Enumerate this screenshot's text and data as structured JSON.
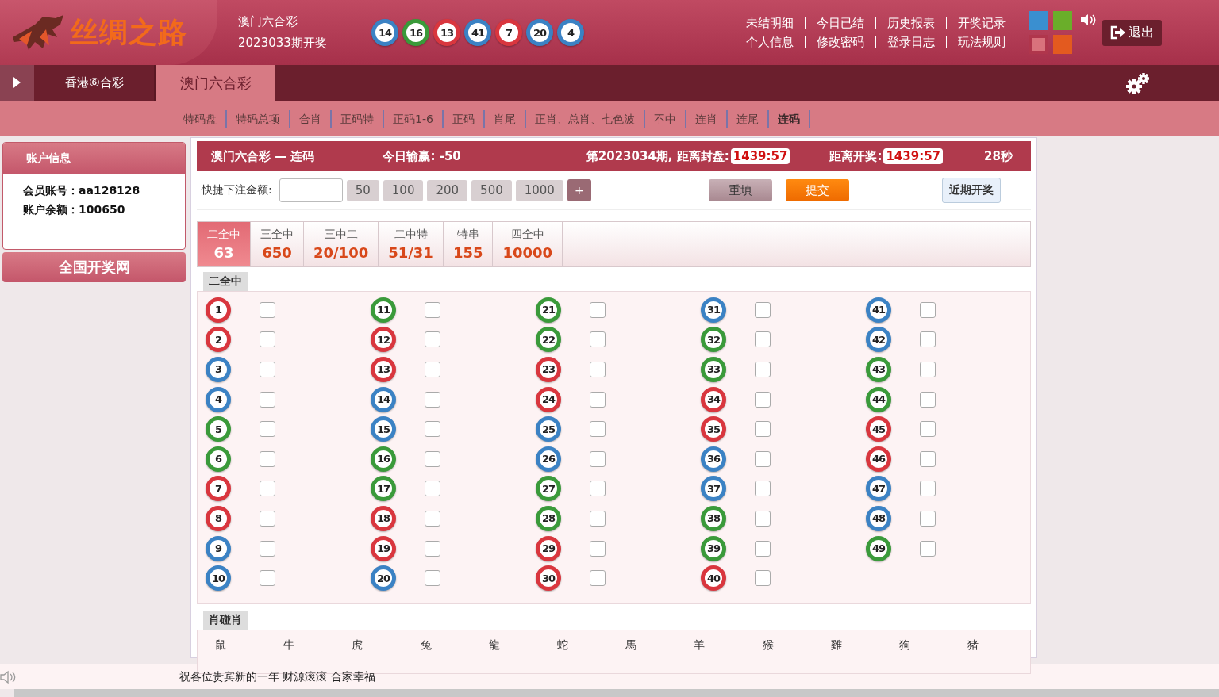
{
  "header": {
    "logo_text": "丝绸之路",
    "draw": {
      "lottery": "澳门六合彩",
      "period": "2023033期开奖",
      "balls": [
        {
          "number": "14",
          "color": "#3b82c4"
        },
        {
          "number": "16",
          "color": "#3a9a3a"
        },
        {
          "number": "13",
          "color": "#d9363e"
        },
        {
          "number": "41",
          "color": "#3b82c4"
        },
        {
          "number": "7",
          "color": "#d9363e"
        },
        {
          "number": "20",
          "color": "#3b82c4"
        },
        {
          "number": "4",
          "color": "#3b82c4"
        }
      ]
    },
    "links": [
      [
        "未结明细",
        "今日已结",
        "历史报表",
        "开奖记录"
      ],
      [
        "个人信息",
        "修改密码",
        "登录日志",
        "玩法规则"
      ]
    ],
    "themes": [
      {
        "color": "#3a8fd0",
        "selected": false
      },
      {
        "color": "#6aae2a",
        "selected": false
      },
      {
        "color": "#d9727c",
        "selected": true
      },
      {
        "color": "#e35a1f",
        "selected": false
      }
    ],
    "logout": "退出"
  },
  "tabs": [
    {
      "label": "香港⑥合彩",
      "selected": false
    },
    {
      "label": "澳门六合彩",
      "selected": true
    }
  ],
  "sub_nav": [
    {
      "label": "特码盘",
      "selected": false
    },
    {
      "label": "特码总项",
      "selected": false
    },
    {
      "label": "合肖",
      "selected": false
    },
    {
      "label": "正码特",
      "selected": false
    },
    {
      "label": "正码1-6",
      "selected": false
    },
    {
      "label": "正码",
      "selected": false
    },
    {
      "label": "肖尾",
      "selected": false
    },
    {
      "label": "正肖、总肖、七色波",
      "selected": false
    },
    {
      "label": "不中",
      "selected": false
    },
    {
      "label": "连肖",
      "selected": false
    },
    {
      "label": "连尾",
      "selected": false
    },
    {
      "label": "连码",
      "selected": true
    }
  ],
  "sidebar": {
    "title": "账户信息",
    "fields": [
      {
        "label": "会员账号：",
        "value": "aa128128"
      },
      {
        "label": "账户余额：",
        "value": "100650"
      }
    ],
    "button": "全国开奖网"
  },
  "panel": {
    "title": "澳门六合彩 — 连码",
    "today_label": "今日输赢:",
    "today_value": "-50",
    "close_label": "第2023034期, 距离封盘:",
    "close_timer": "1439:57",
    "draw_label": "距离开奖:",
    "draw_timer": "1439:57",
    "countdown": "28秒",
    "quick_label": "快捷下注金额:",
    "amounts": [
      "50",
      "100",
      "200",
      "500",
      "1000"
    ],
    "add": "+",
    "reset": "重填",
    "submit": "提交",
    "recent": "近期开奖",
    "play_types": [
      {
        "name": "二全中",
        "odds": "63",
        "selected": true
      },
      {
        "name": "三全中",
        "odds": "650",
        "selected": false
      },
      {
        "name": "三中二",
        "odds": "20/100",
        "selected": false
      },
      {
        "name": "二中特",
        "odds": "51/31",
        "selected": false
      },
      {
        "name": "特串",
        "odds": "155",
        "selected": false
      },
      {
        "name": "四全中",
        "odds": "10000",
        "selected": false
      }
    ],
    "numbers_title": "二全中",
    "numbers": [
      {
        "number": "1",
        "color": "#d9363e",
        "checked": false
      },
      {
        "number": "2",
        "color": "#d9363e",
        "checked": false
      },
      {
        "number": "3",
        "color": "#3b82c4",
        "checked": false
      },
      {
        "number": "4",
        "color": "#3b82c4",
        "checked": false
      },
      {
        "number": "5",
        "color": "#3a9a3a",
        "checked": false
      },
      {
        "number": "6",
        "color": "#3a9a3a",
        "checked": false
      },
      {
        "number": "7",
        "color": "#d9363e",
        "checked": false
      },
      {
        "number": "8",
        "color": "#d9363e",
        "checked": false
      },
      {
        "number": "9",
        "color": "#3b82c4",
        "checked": false
      },
      {
        "number": "10",
        "color": "#3b82c4",
        "checked": false
      },
      {
        "number": "11",
        "color": "#3a9a3a",
        "checked": false
      },
      {
        "number": "12",
        "color": "#d9363e",
        "checked": false
      },
      {
        "number": "13",
        "color": "#d9363e",
        "checked": false
      },
      {
        "number": "14",
        "color": "#3b82c4",
        "checked": false
      },
      {
        "number": "15",
        "color": "#3b82c4",
        "checked": false
      },
      {
        "number": "16",
        "color": "#3a9a3a",
        "checked": false
      },
      {
        "number": "17",
        "color": "#3a9a3a",
        "checked": false
      },
      {
        "number": "18",
        "color": "#d9363e",
        "checked": false
      },
      {
        "number": "19",
        "color": "#d9363e",
        "checked": false
      },
      {
        "number": "20",
        "color": "#3b82c4",
        "checked": false
      },
      {
        "number": "21",
        "color": "#3a9a3a",
        "checked": false
      },
      {
        "number": "22",
        "color": "#3a9a3a",
        "checked": false
      },
      {
        "number": "23",
        "color": "#d9363e",
        "checked": false
      },
      {
        "number": "24",
        "color": "#d9363e",
        "checked": false
      },
      {
        "number": "25",
        "color": "#3b82c4",
        "checked": false
      },
      {
        "number": "26",
        "color": "#3b82c4",
        "checked": false
      },
      {
        "number": "27",
        "color": "#3a9a3a",
        "checked": false
      },
      {
        "number": "28",
        "color": "#3a9a3a",
        "checked": false
      },
      {
        "number": "29",
        "color": "#d9363e",
        "checked": false
      },
      {
        "number": "30",
        "color": "#d9363e",
        "checked": false
      },
      {
        "number": "31",
        "color": "#3b82c4",
        "checked": false
      },
      {
        "number": "32",
        "color": "#3a9a3a",
        "checked": false
      },
      {
        "number": "33",
        "color": "#3a9a3a",
        "checked": false
      },
      {
        "number": "34",
        "color": "#d9363e",
        "checked": false
      },
      {
        "number": "35",
        "color": "#d9363e",
        "checked": false
      },
      {
        "number": "36",
        "color": "#3b82c4",
        "checked": false
      },
      {
        "number": "37",
        "color": "#3b82c4",
        "checked": false
      },
      {
        "number": "38",
        "color": "#3a9a3a",
        "checked": false
      },
      {
        "number": "39",
        "color": "#3a9a3a",
        "checked": false
      },
      {
        "number": "40",
        "color": "#d9363e",
        "checked": false
      },
      {
        "number": "41",
        "color": "#3b82c4",
        "checked": false
      },
      {
        "number": "42",
        "color": "#3b82c4",
        "checked": false
      },
      {
        "number": "43",
        "color": "#3a9a3a",
        "checked": false
      },
      {
        "number": "44",
        "color": "#3a9a3a",
        "checked": false
      },
      {
        "number": "45",
        "color": "#d9363e",
        "checked": false
      },
      {
        "number": "46",
        "color": "#d9363e",
        "checked": false
      },
      {
        "number": "47",
        "color": "#3b82c4",
        "checked": false
      },
      {
        "number": "48",
        "color": "#3b82c4",
        "checked": false
      },
      {
        "number": "49",
        "color": "#3a9a3a",
        "checked": false
      }
    ],
    "zodiac_title": "肖碰肖",
    "zodiac": [
      "鼠",
      "牛",
      "虎",
      "兔",
      "龍",
      "蛇",
      "馬",
      "羊",
      "猴",
      "雞",
      "狗",
      "猪"
    ]
  },
  "footer": {
    "message": "祝各位贵宾新的一年 财源滚滚 合家幸福"
  }
}
